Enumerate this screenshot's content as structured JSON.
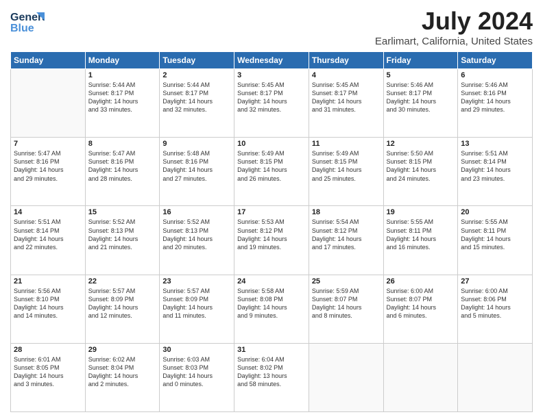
{
  "header": {
    "logo_line1": "General",
    "logo_line2": "Blue",
    "title": "July 2024",
    "subtitle": "Earlimart, California, United States"
  },
  "weekdays": [
    "Sunday",
    "Monday",
    "Tuesday",
    "Wednesday",
    "Thursday",
    "Friday",
    "Saturday"
  ],
  "weeks": [
    [
      {
        "day": "",
        "content": ""
      },
      {
        "day": "1",
        "content": "Sunrise: 5:44 AM\nSunset: 8:17 PM\nDaylight: 14 hours\nand 33 minutes."
      },
      {
        "day": "2",
        "content": "Sunrise: 5:44 AM\nSunset: 8:17 PM\nDaylight: 14 hours\nand 32 minutes."
      },
      {
        "day": "3",
        "content": "Sunrise: 5:45 AM\nSunset: 8:17 PM\nDaylight: 14 hours\nand 32 minutes."
      },
      {
        "day": "4",
        "content": "Sunrise: 5:45 AM\nSunset: 8:17 PM\nDaylight: 14 hours\nand 31 minutes."
      },
      {
        "day": "5",
        "content": "Sunrise: 5:46 AM\nSunset: 8:17 PM\nDaylight: 14 hours\nand 30 minutes."
      },
      {
        "day": "6",
        "content": "Sunrise: 5:46 AM\nSunset: 8:16 PM\nDaylight: 14 hours\nand 29 minutes."
      }
    ],
    [
      {
        "day": "7",
        "content": "Sunrise: 5:47 AM\nSunset: 8:16 PM\nDaylight: 14 hours\nand 29 minutes."
      },
      {
        "day": "8",
        "content": "Sunrise: 5:47 AM\nSunset: 8:16 PM\nDaylight: 14 hours\nand 28 minutes."
      },
      {
        "day": "9",
        "content": "Sunrise: 5:48 AM\nSunset: 8:16 PM\nDaylight: 14 hours\nand 27 minutes."
      },
      {
        "day": "10",
        "content": "Sunrise: 5:49 AM\nSunset: 8:15 PM\nDaylight: 14 hours\nand 26 minutes."
      },
      {
        "day": "11",
        "content": "Sunrise: 5:49 AM\nSunset: 8:15 PM\nDaylight: 14 hours\nand 25 minutes."
      },
      {
        "day": "12",
        "content": "Sunrise: 5:50 AM\nSunset: 8:15 PM\nDaylight: 14 hours\nand 24 minutes."
      },
      {
        "day": "13",
        "content": "Sunrise: 5:51 AM\nSunset: 8:14 PM\nDaylight: 14 hours\nand 23 minutes."
      }
    ],
    [
      {
        "day": "14",
        "content": "Sunrise: 5:51 AM\nSunset: 8:14 PM\nDaylight: 14 hours\nand 22 minutes."
      },
      {
        "day": "15",
        "content": "Sunrise: 5:52 AM\nSunset: 8:13 PM\nDaylight: 14 hours\nand 21 minutes."
      },
      {
        "day": "16",
        "content": "Sunrise: 5:52 AM\nSunset: 8:13 PM\nDaylight: 14 hours\nand 20 minutes."
      },
      {
        "day": "17",
        "content": "Sunrise: 5:53 AM\nSunset: 8:12 PM\nDaylight: 14 hours\nand 19 minutes."
      },
      {
        "day": "18",
        "content": "Sunrise: 5:54 AM\nSunset: 8:12 PM\nDaylight: 14 hours\nand 17 minutes."
      },
      {
        "day": "19",
        "content": "Sunrise: 5:55 AM\nSunset: 8:11 PM\nDaylight: 14 hours\nand 16 minutes."
      },
      {
        "day": "20",
        "content": "Sunrise: 5:55 AM\nSunset: 8:11 PM\nDaylight: 14 hours\nand 15 minutes."
      }
    ],
    [
      {
        "day": "21",
        "content": "Sunrise: 5:56 AM\nSunset: 8:10 PM\nDaylight: 14 hours\nand 14 minutes."
      },
      {
        "day": "22",
        "content": "Sunrise: 5:57 AM\nSunset: 8:09 PM\nDaylight: 14 hours\nand 12 minutes."
      },
      {
        "day": "23",
        "content": "Sunrise: 5:57 AM\nSunset: 8:09 PM\nDaylight: 14 hours\nand 11 minutes."
      },
      {
        "day": "24",
        "content": "Sunrise: 5:58 AM\nSunset: 8:08 PM\nDaylight: 14 hours\nand 9 minutes."
      },
      {
        "day": "25",
        "content": "Sunrise: 5:59 AM\nSunset: 8:07 PM\nDaylight: 14 hours\nand 8 minutes."
      },
      {
        "day": "26",
        "content": "Sunrise: 6:00 AM\nSunset: 8:07 PM\nDaylight: 14 hours\nand 6 minutes."
      },
      {
        "day": "27",
        "content": "Sunrise: 6:00 AM\nSunset: 8:06 PM\nDaylight: 14 hours\nand 5 minutes."
      }
    ],
    [
      {
        "day": "28",
        "content": "Sunrise: 6:01 AM\nSunset: 8:05 PM\nDaylight: 14 hours\nand 3 minutes."
      },
      {
        "day": "29",
        "content": "Sunrise: 6:02 AM\nSunset: 8:04 PM\nDaylight: 14 hours\nand 2 minutes."
      },
      {
        "day": "30",
        "content": "Sunrise: 6:03 AM\nSunset: 8:03 PM\nDaylight: 14 hours\nand 0 minutes."
      },
      {
        "day": "31",
        "content": "Sunrise: 6:04 AM\nSunset: 8:02 PM\nDaylight: 13 hours\nand 58 minutes."
      },
      {
        "day": "",
        "content": ""
      },
      {
        "day": "",
        "content": ""
      },
      {
        "day": "",
        "content": ""
      }
    ]
  ]
}
